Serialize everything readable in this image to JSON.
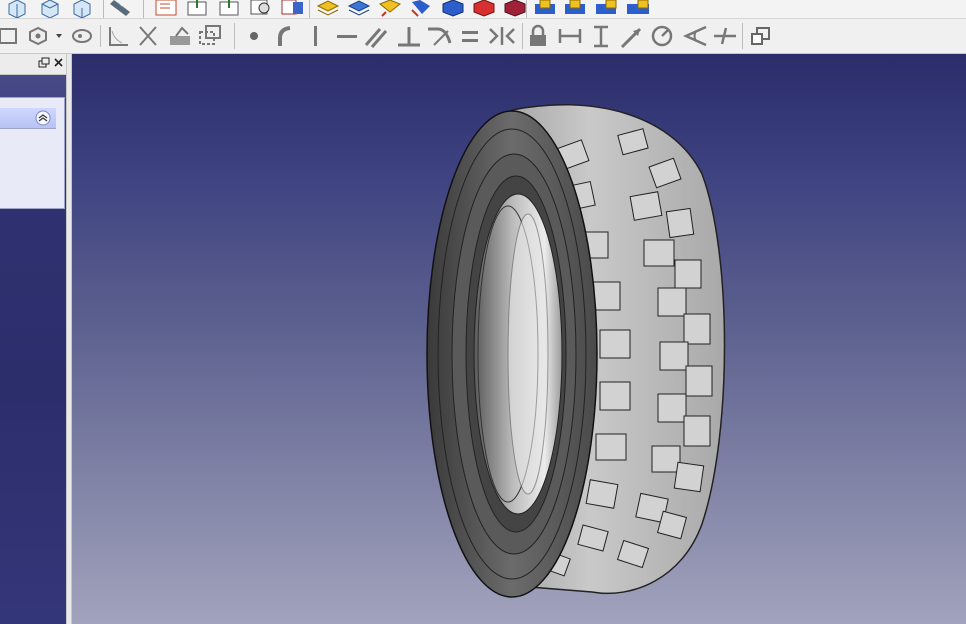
{
  "toolbar_top": {
    "icons": [
      "view-cube-icon",
      "view-cube-icon",
      "view-cube-icon",
      "measure-icon",
      "new-document-icon",
      "export-icon",
      "export-icon",
      "zoom-icon",
      "part-icon",
      "layers-icon",
      "layers-icon",
      "layers-icon",
      "layers-icon",
      "block-icon",
      "block-icon",
      "block-icon",
      "lock-block-icon",
      "lock-block-icon",
      "lock-block-icon",
      "lock-block-icon"
    ]
  },
  "toolbar_sketch": {
    "icons": [
      "rectangle-icon",
      "polygon-icon",
      "dropdown-arrow-icon",
      "slot-icon",
      "fillet-icon",
      "trim-icon",
      "extend-icon",
      "external-geometry-icon",
      "point-icon",
      "arc-icon",
      "vertical-icon",
      "horizontal-icon",
      "parallel-icon",
      "perpendicular-icon",
      "tangent-icon",
      "equal-icon",
      "symmetric-icon",
      "lock-icon",
      "horizontal-distance-icon",
      "vertical-distance-icon",
      "distance-icon",
      "radius-icon",
      "angle-icon",
      "snell-icon",
      "clone-icon"
    ]
  },
  "panel": {
    "restore_button": "restore-icon",
    "close_button": "close-icon",
    "collapse_button": "collapse-icon"
  },
  "viewport": {
    "model": "tire"
  },
  "colors": {
    "viewport_top": "#2b2d6a",
    "viewport_bottom": "#a2a3bd",
    "tire": "#b8b8b8"
  }
}
